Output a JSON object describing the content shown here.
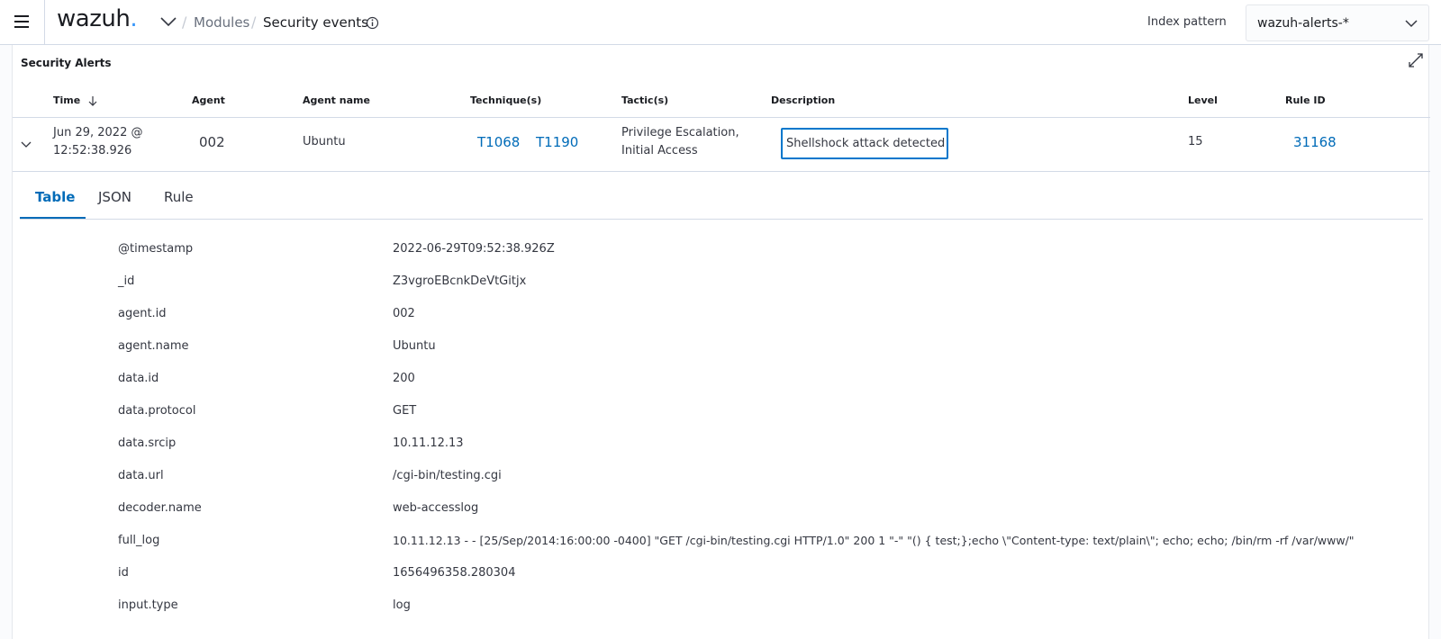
{
  "header": {
    "logo_text": "wazuh",
    "logo_dot": ".",
    "breadcrumb_1": "Modules",
    "breadcrumb_2": "Security events",
    "index_pattern_label": "Index pattern",
    "index_pattern_value": "wazuh-alerts-*"
  },
  "panel": {
    "title": "Security Alerts",
    "columns": {
      "time": "Time",
      "agent": "Agent",
      "agent_name": "Agent name",
      "techniques": "Technique(s)",
      "tactics": "Tactic(s)",
      "description": "Description",
      "level": "Level",
      "rule_id": "Rule ID"
    },
    "row": {
      "time_line1": "Jun 29, 2022 @",
      "time_line2": "12:52:38.926",
      "agent": "002",
      "agent_name": "Ubuntu",
      "technique_1": "T1068",
      "technique_2": "T1190",
      "tactic_line1": "Privilege Escalation,",
      "tactic_line2": "Initial Access",
      "description": "Shellshock attack detected",
      "level": "15",
      "rule_id": "31168"
    }
  },
  "tabs": [
    "Table",
    "JSON",
    "Rule"
  ],
  "details": [
    {
      "key": "@timestamp",
      "value": "2022-06-29T09:52:38.926Z"
    },
    {
      "key": "_id",
      "value": "Z3vgroEBcnkDeVtGitjx"
    },
    {
      "key": "agent.id",
      "value": "002"
    },
    {
      "key": "agent.name",
      "value": "Ubuntu"
    },
    {
      "key": "data.id",
      "value": "200"
    },
    {
      "key": "data.protocol",
      "value": "GET"
    },
    {
      "key": "data.srcip",
      "value": "10.11.12.13"
    },
    {
      "key": "data.url",
      "value": "/cgi-bin/testing.cgi"
    },
    {
      "key": "decoder.name",
      "value": "web-accesslog"
    },
    {
      "key": "full_log",
      "value": "10.11.12.13 - - [25/Sep/2014:16:00:00 -0400] \"GET /cgi-bin/testing.cgi HTTP/1.0\" 200 1 \"-\" \"() { test;};echo \\\"Content-type: text/plain\\\"; echo; echo; /bin/rm -rf /var/www/\""
    },
    {
      "key": "id",
      "value": "1656496358.280304"
    },
    {
      "key": "input.type",
      "value": "log"
    }
  ],
  "icons": {
    "menu": "hamburger-menu-icon",
    "logo_chevron": "chevron-down-icon",
    "info": "info-icon",
    "select_chevron": "chevron-down-icon",
    "expand": "fullscreen-expand-icon",
    "sort": "arrow-down-icon",
    "row_toggle": "chevron-down-icon"
  },
  "colors": {
    "link": "#006bb8",
    "logo_dot": "#3595f9",
    "focus": "#0077cc"
  }
}
